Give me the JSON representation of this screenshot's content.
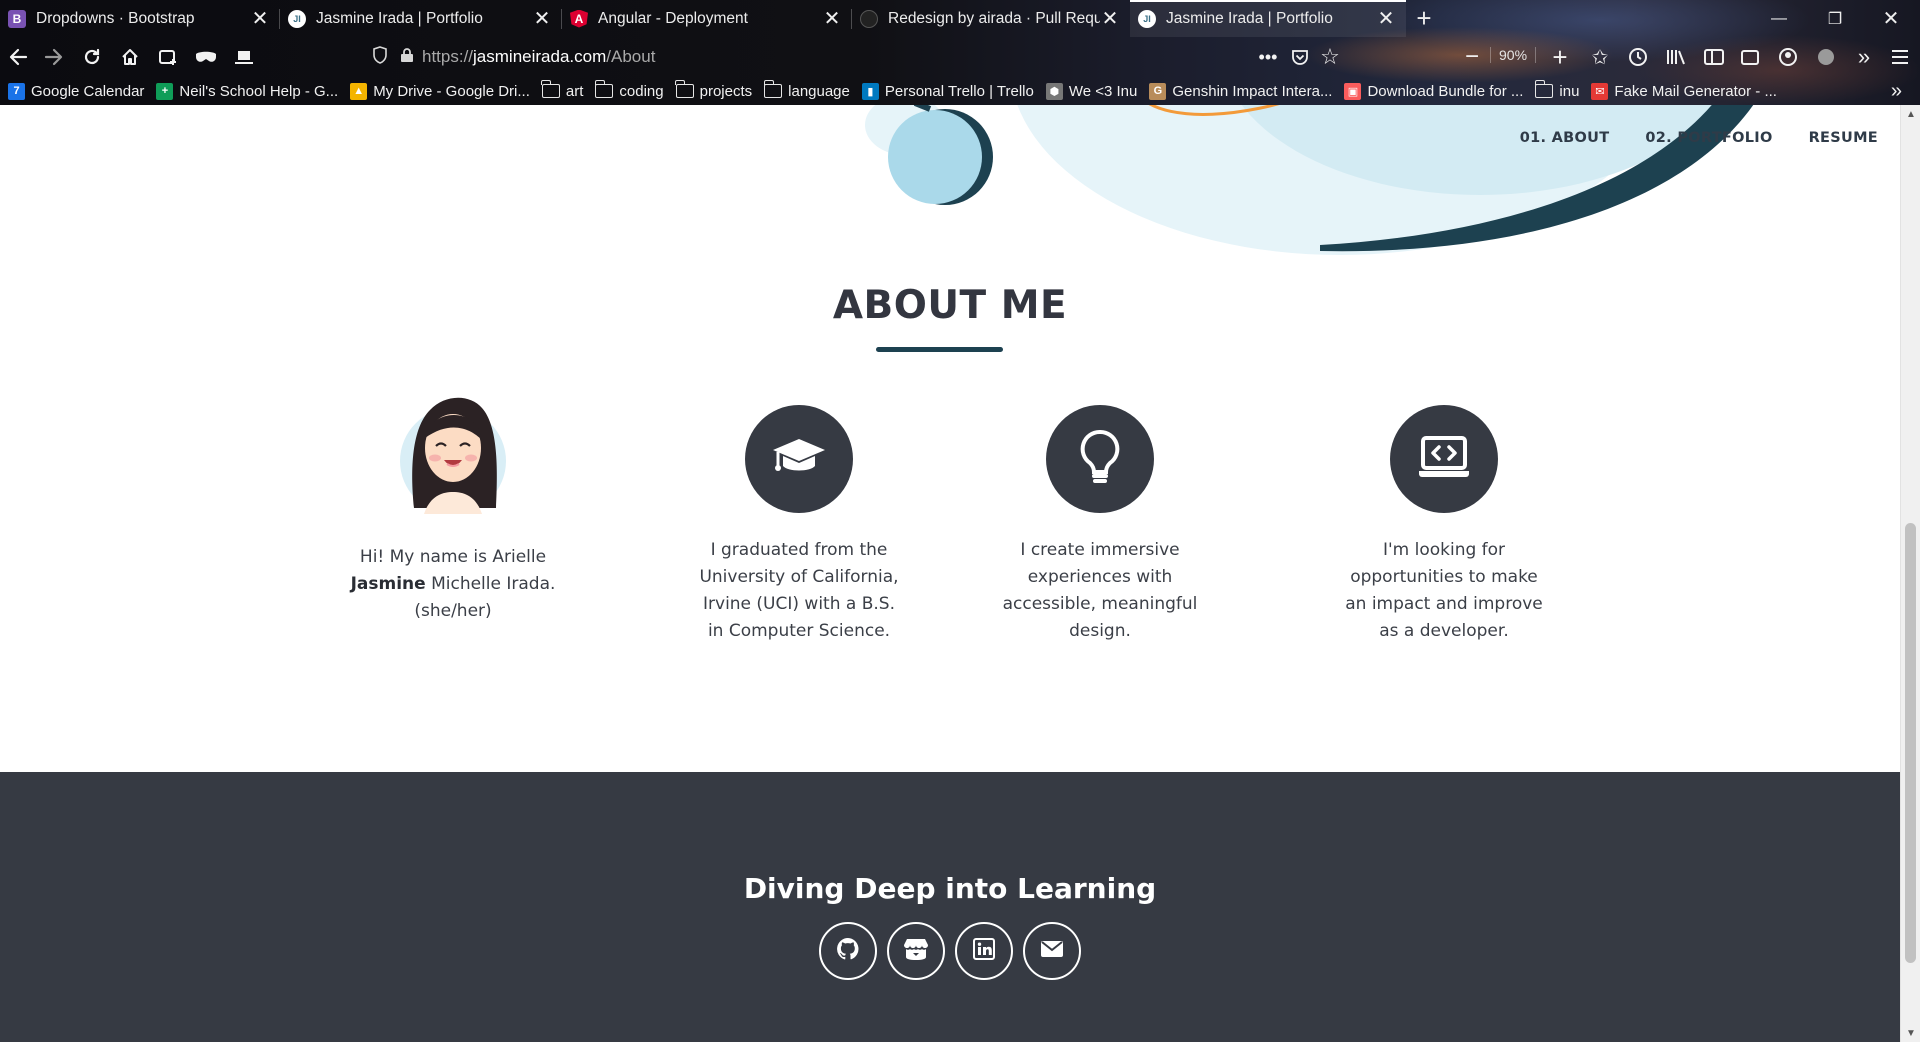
{
  "browser": {
    "tabs": [
      {
        "title": "Dropdowns · Bootstrap",
        "favicon": "bootstrap-icon",
        "fav_char": "B",
        "fav_color": "#7952b3"
      },
      {
        "title": "Jasmine Irada | Portfolio",
        "favicon": "portfolio-icon",
        "fav_char": "JI",
        "fav_color": "#9fd3e6"
      },
      {
        "title": "Angular - Deployment",
        "favicon": "angular-icon",
        "fav_char": "A",
        "fav_color": "#dd0031"
      },
      {
        "title": "Redesign by airada · Pull Reque",
        "favicon": "github-icon",
        "fav_char": "",
        "fav_color": "#333333"
      },
      {
        "title": "Jasmine Irada | Portfolio",
        "favicon": "portfolio-icon",
        "fav_char": "JI",
        "fav_color": "#9fd3e6",
        "active": true
      }
    ],
    "url": {
      "protocol": "https://",
      "host": "jasmineirada.com",
      "path": "/About"
    },
    "zoom": "90%",
    "bookmarks": [
      {
        "label": "Google Calendar",
        "icon": "calendar-icon",
        "type": "link",
        "color": "#1a73e8",
        "char": "7"
      },
      {
        "label": "Neil's School Help - G...",
        "icon": "sheets-icon",
        "type": "link",
        "color": "#0f9d58",
        "char": "+"
      },
      {
        "label": "My Drive - Google Dri...",
        "icon": "drive-icon",
        "type": "link",
        "color": "#f4b400",
        "char": "▲"
      },
      {
        "label": "art",
        "icon": "folder-icon",
        "type": "folder"
      },
      {
        "label": "coding",
        "icon": "folder-icon",
        "type": "folder"
      },
      {
        "label": "projects",
        "icon": "folder-icon",
        "type": "folder"
      },
      {
        "label": "language",
        "icon": "folder-icon",
        "type": "folder"
      },
      {
        "label": "Personal Trello | Trello",
        "icon": "trello-icon",
        "type": "link",
        "color": "#0079bf",
        "char": "▮"
      },
      {
        "label": "We <3 Inu",
        "icon": "inu-icon",
        "type": "link",
        "color": "#777777",
        "char": "⬢"
      },
      {
        "label": "Genshin Impact Intera...",
        "icon": "genshin-icon",
        "type": "link",
        "color": "#b88c5a",
        "char": "G"
      },
      {
        "label": "Download Bundle for ...",
        "icon": "itchio-icon",
        "type": "link",
        "color": "#fa5c5c",
        "char": "▣"
      },
      {
        "label": "inu",
        "icon": "folder-icon",
        "type": "folder"
      },
      {
        "label": "Fake Mail Generator - ...",
        "icon": "mail-icon",
        "type": "link",
        "color": "#e53935",
        "char": "✉"
      }
    ]
  },
  "page": {
    "nav": {
      "about": "01. ABOUT",
      "portfolio": "02. PORTFOLIO",
      "resume": "RESUME"
    },
    "about_title": "ABOUT ME",
    "cards": [
      {
        "icon": "avatar",
        "line1": "Hi! My name is Arielle",
        "bold": "Jasmine",
        "line2_rest": " Michelle Irada.",
        "line3": "(she/her)"
      },
      {
        "icon": "graduation-cap-icon",
        "lines": [
          "I graduated from the",
          "University of California,",
          "Irvine (UCI) with a B.S.",
          "in Computer Science."
        ]
      },
      {
        "icon": "lightbulb-icon",
        "lines": [
          "I create immersive",
          "experiences with",
          "accessible, meaningful",
          "design."
        ]
      },
      {
        "icon": "laptop-code-icon",
        "lines": [
          "I'm looking for",
          "opportunities to make",
          "an impact and improve",
          "as a developer."
        ]
      }
    ],
    "footer": {
      "title": "Diving Deep into Learning",
      "socials": [
        "github-icon",
        "itchio-icon",
        "linkedin-icon",
        "email-icon"
      ]
    }
  },
  "colors": {
    "dark": "#363a43",
    "accent": "#1d4150",
    "light_blue": "#aad9ea"
  }
}
